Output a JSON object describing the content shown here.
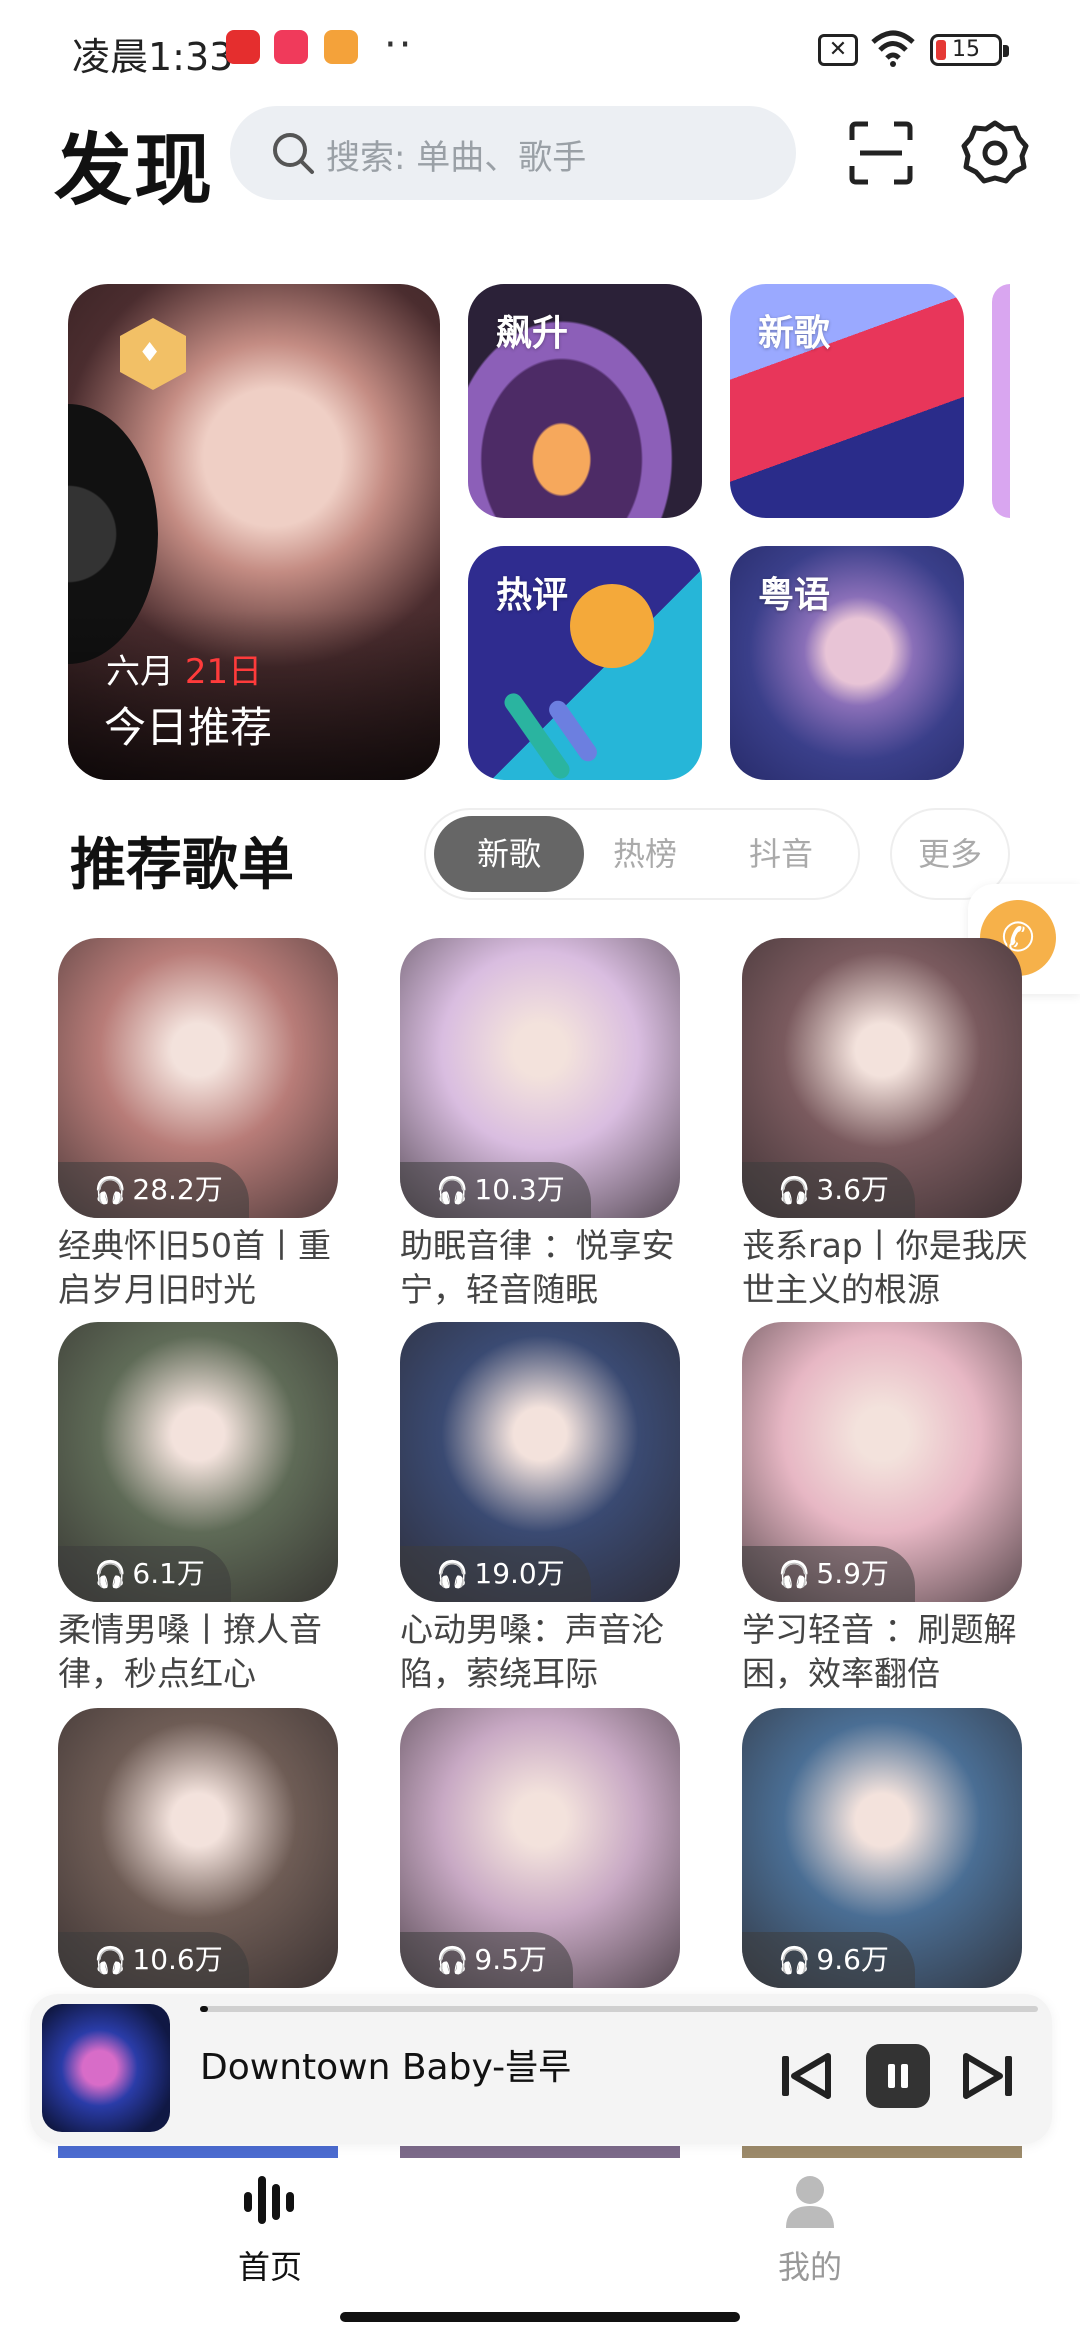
{
  "status_bar": {
    "time": "凌晨1:33",
    "battery": "15",
    "app_badges": [
      "#e52e2e",
      "#f03a5b",
      "#f4a23a"
    ],
    "overflow": "··"
  },
  "header": {
    "title": "发现",
    "search_placeholder": "搜索: 单曲、歌手"
  },
  "featured": {
    "daily": {
      "month": "六月",
      "day": "21日",
      "label": "今日推荐"
    },
    "tiles": [
      "飙升",
      "新歌",
      "热评",
      "粤语"
    ]
  },
  "section": {
    "title": "推荐歌单",
    "tabs": [
      "新歌",
      "热榜",
      "抖音"
    ],
    "active_tab": "新歌",
    "more_label": "更多"
  },
  "playlists": [
    {
      "name": "经典怀旧50首丨重启岁月旧时光",
      "plays": "28.2万",
      "color": "#b87c78"
    },
    {
      "name": "助眠音律 ：悦享安宁，轻音随眠",
      "plays": "10.3万",
      "color": "#d9bde0"
    },
    {
      "name": "丧系rap丨你是我厌世主义的根源",
      "plays": "3.6万",
      "color": "#7a5a5e"
    },
    {
      "name": "柔情男嗓丨撩人音律，秒点红心",
      "plays": "6.1万",
      "color": "#5f6b57"
    },
    {
      "name": "心动男嗓：声音沦陷，萦绕耳际",
      "plays": "19.0万",
      "color": "#3a4a72"
    },
    {
      "name": "学习轻音 ：刷题解困，效率翻倍",
      "plays": "5.9万",
      "color": "#e7b7c4"
    },
    {
      "name": "",
      "plays": "10.6万",
      "color": "#6e5c55"
    },
    {
      "name": "",
      "plays": "9.5万",
      "color": "#c8a9c4"
    },
    {
      "name": "",
      "plays": "9.6万",
      "color": "#4a6e94"
    }
  ],
  "player": {
    "song": "Downtown Baby-블루",
    "progress": 0.01
  },
  "nav": {
    "home": "首页",
    "mine": "我的",
    "active": "首页"
  }
}
